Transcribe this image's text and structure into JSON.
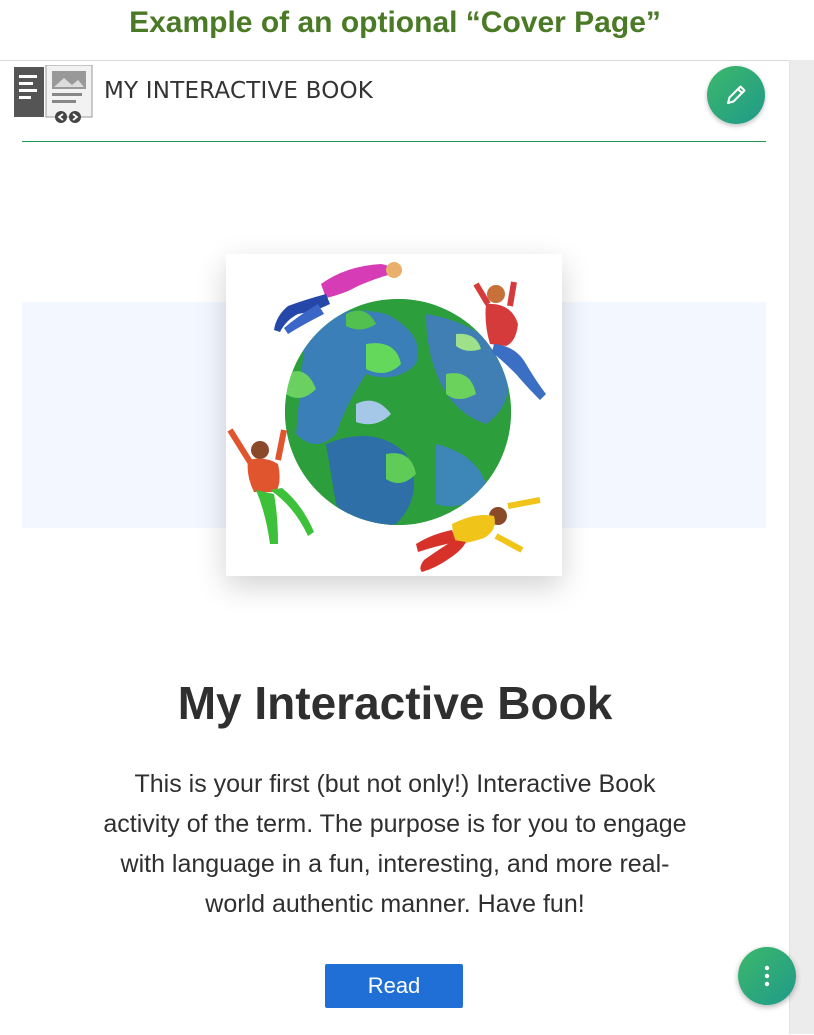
{
  "caption": "Example of an optional “Cover Page”",
  "header": {
    "app_title": "MY INTERACTIVE BOOK",
    "edit_icon": "pencil-icon",
    "app_icon": "interactive-book-icon"
  },
  "cover": {
    "image": "earth-globe-with-people-illustration"
  },
  "book": {
    "title": "My Interactive Book",
    "description": "This is your first (but not only!) Interactive Book activity of the term. The purpose is for you to engage with language in a fun, interesting, and more real-world authentic manner. Have fun!",
    "read_label": "Read"
  },
  "fab": {
    "icon": "more-vertical-icon"
  },
  "colors": {
    "caption": "#4a7a26",
    "accent_green": "#1e9652",
    "read_button": "#1f6fd6",
    "band": "#f3f7ff"
  }
}
